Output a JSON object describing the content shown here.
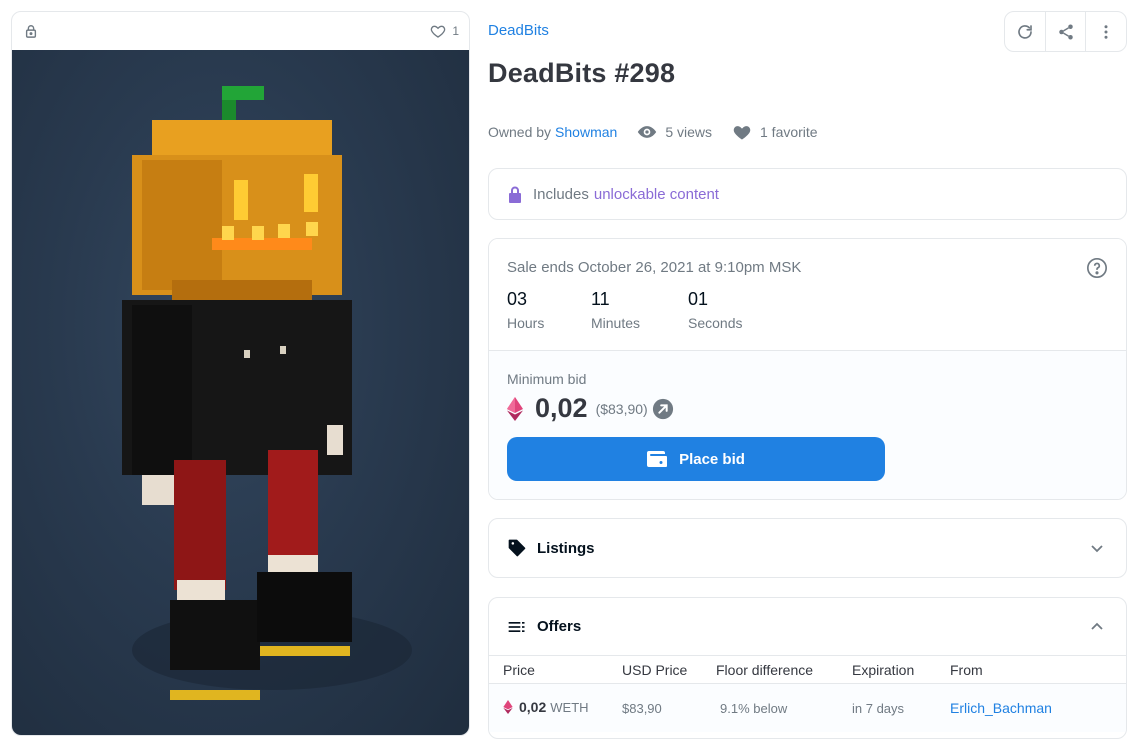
{
  "asset": {
    "collection": "DeadBits",
    "title": "DeadBits #298",
    "favorites_count": "1"
  },
  "meta": {
    "owned_by_prefix": "Owned by",
    "owner": "Showman",
    "views": "5 views",
    "favorites": "1 favorite"
  },
  "unlockable": {
    "prefix": "Includes",
    "link": "unlockable content"
  },
  "sale": {
    "ends_text": "Sale ends October 26, 2021 at 9:10pm MSK",
    "countdown": [
      {
        "value": "03",
        "label": "Hours"
      },
      {
        "value": "11",
        "label": "Minutes"
      },
      {
        "value": "01",
        "label": "Seconds"
      }
    ],
    "min_bid_label": "Minimum bid",
    "price": "0,02",
    "price_usd": "($83,90)",
    "place_bid_label": "Place bid"
  },
  "listings": {
    "title": "Listings"
  },
  "offers": {
    "title": "Offers",
    "columns": [
      "Price",
      "USD Price",
      "Floor difference",
      "Expiration",
      "From"
    ],
    "rows": [
      {
        "amount": "0,02",
        "currency": "WETH",
        "usd": "$83,90",
        "floor_diff": "9.1% below",
        "expiration": "in 7 days",
        "from": "Erlich_Bachman"
      }
    ]
  },
  "icons": {
    "toolbar": [
      "refresh-icon",
      "share-icon",
      "more-vertical-icon"
    ],
    "accent": "#2081e2",
    "unlock_color": "#8a6bd6"
  }
}
